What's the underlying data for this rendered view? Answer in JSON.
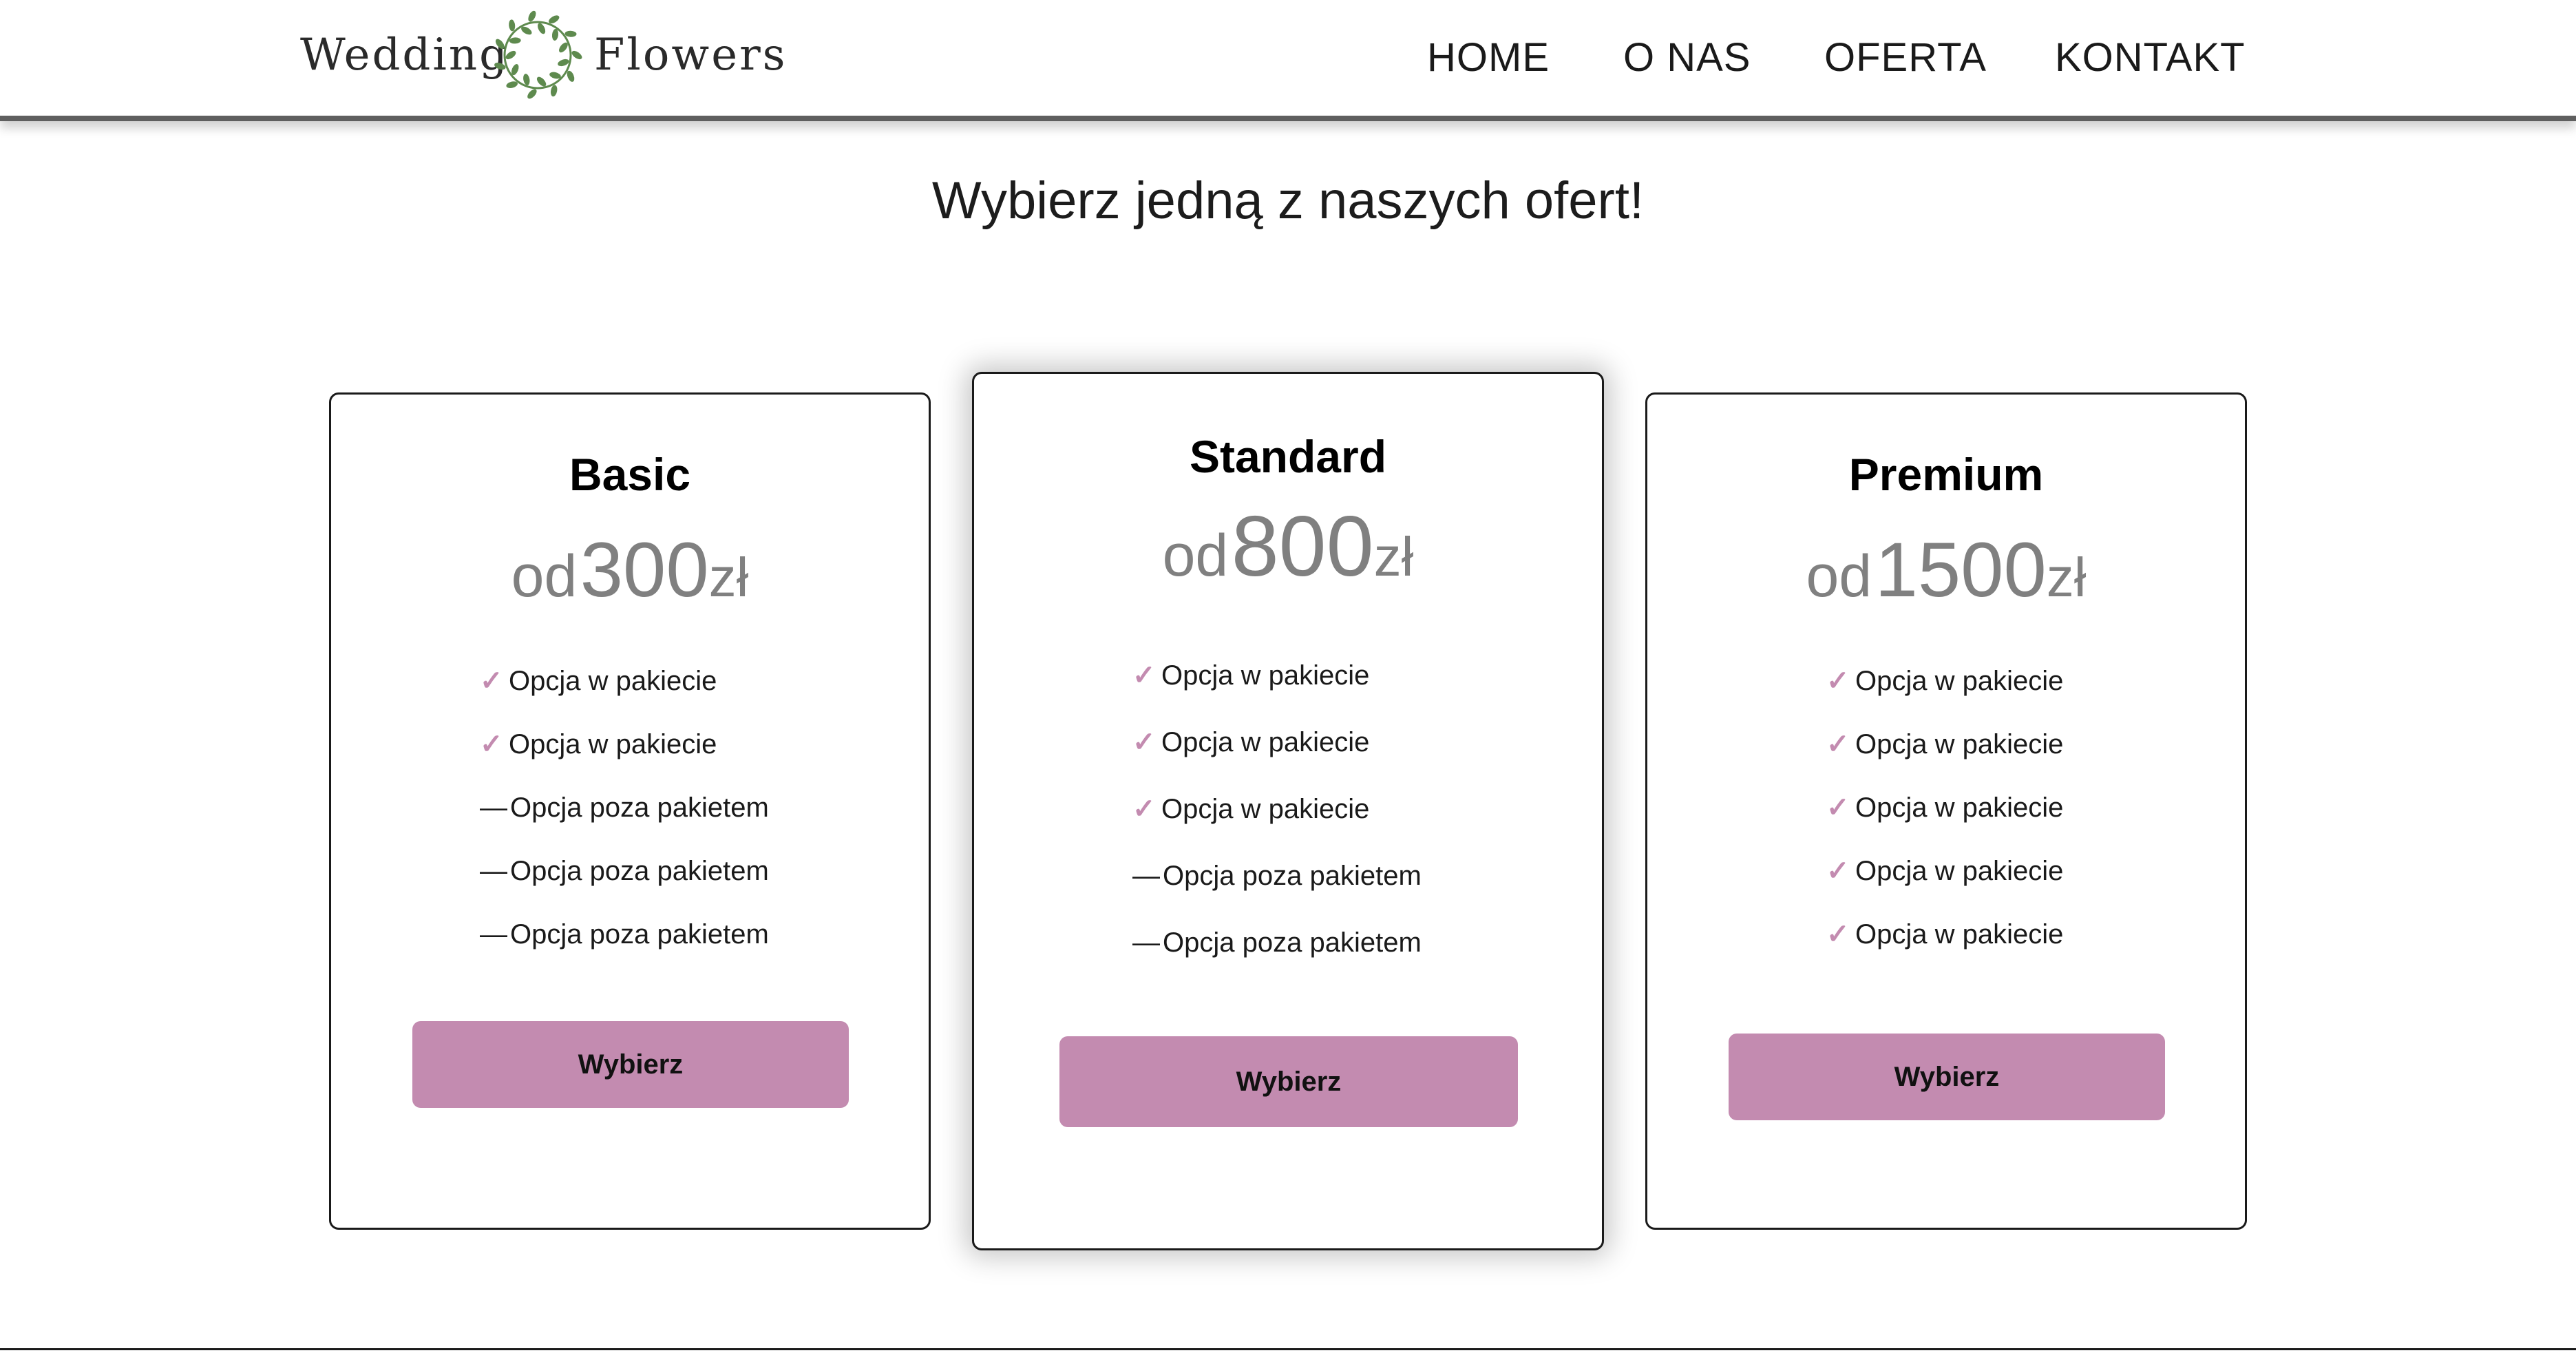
{
  "brand": {
    "word_left": "Wedding",
    "word_right": "Flowers",
    "wreath_icon": "laurel-wreath-icon",
    "wreath_color": "#5e8a4e"
  },
  "nav": {
    "items": [
      {
        "label": "HOME"
      },
      {
        "label": "O NAS"
      },
      {
        "label": "OFERTA"
      },
      {
        "label": "KONTAKT"
      }
    ]
  },
  "main": {
    "title": "Wybierz jedną z naszych ofert!"
  },
  "colors": {
    "accent": "#c38bb0",
    "price_text": "#808080",
    "text": "#1a1a1a"
  },
  "plans": [
    {
      "name": "Basic",
      "price_prefix": "od",
      "price_value": "300",
      "price_currency": "zł",
      "features": [
        {
          "mark": "✓",
          "type": "included",
          "text": "Opcja w pakiecie"
        },
        {
          "mark": "✓",
          "type": "included",
          "text": "Opcja w pakiecie"
        },
        {
          "mark": "—",
          "type": "excluded",
          "text": "Opcja poza pakietem"
        },
        {
          "mark": "—",
          "type": "excluded",
          "text": "Opcja poza pakietem"
        },
        {
          "mark": "—",
          "type": "excluded",
          "text": "Opcja poza pakietem"
        }
      ],
      "button_label": "Wybierz"
    },
    {
      "name": "Standard",
      "price_prefix": "od",
      "price_value": "800",
      "price_currency": "zł",
      "features": [
        {
          "mark": "✓",
          "type": "included",
          "text": "Opcja w pakiecie"
        },
        {
          "mark": "✓",
          "type": "included",
          "text": "Opcja w pakiecie"
        },
        {
          "mark": "✓",
          "type": "included",
          "text": "Opcja w pakiecie"
        },
        {
          "mark": "—",
          "type": "excluded",
          "text": "Opcja poza pakietem"
        },
        {
          "mark": "—",
          "type": "excluded",
          "text": "Opcja poza pakietem"
        }
      ],
      "button_label": "Wybierz"
    },
    {
      "name": "Premium",
      "price_prefix": "od",
      "price_value": "1500",
      "price_currency": "zł",
      "features": [
        {
          "mark": "✓",
          "type": "included",
          "text": "Opcja w pakiecie"
        },
        {
          "mark": "✓",
          "type": "included",
          "text": "Opcja w pakiecie"
        },
        {
          "mark": "✓",
          "type": "included",
          "text": "Opcja w pakiecie"
        },
        {
          "mark": "✓",
          "type": "included",
          "text": "Opcja w pakiecie"
        },
        {
          "mark": "✓",
          "type": "included",
          "text": "Opcja w pakiecie"
        }
      ],
      "button_label": "Wybierz"
    }
  ]
}
